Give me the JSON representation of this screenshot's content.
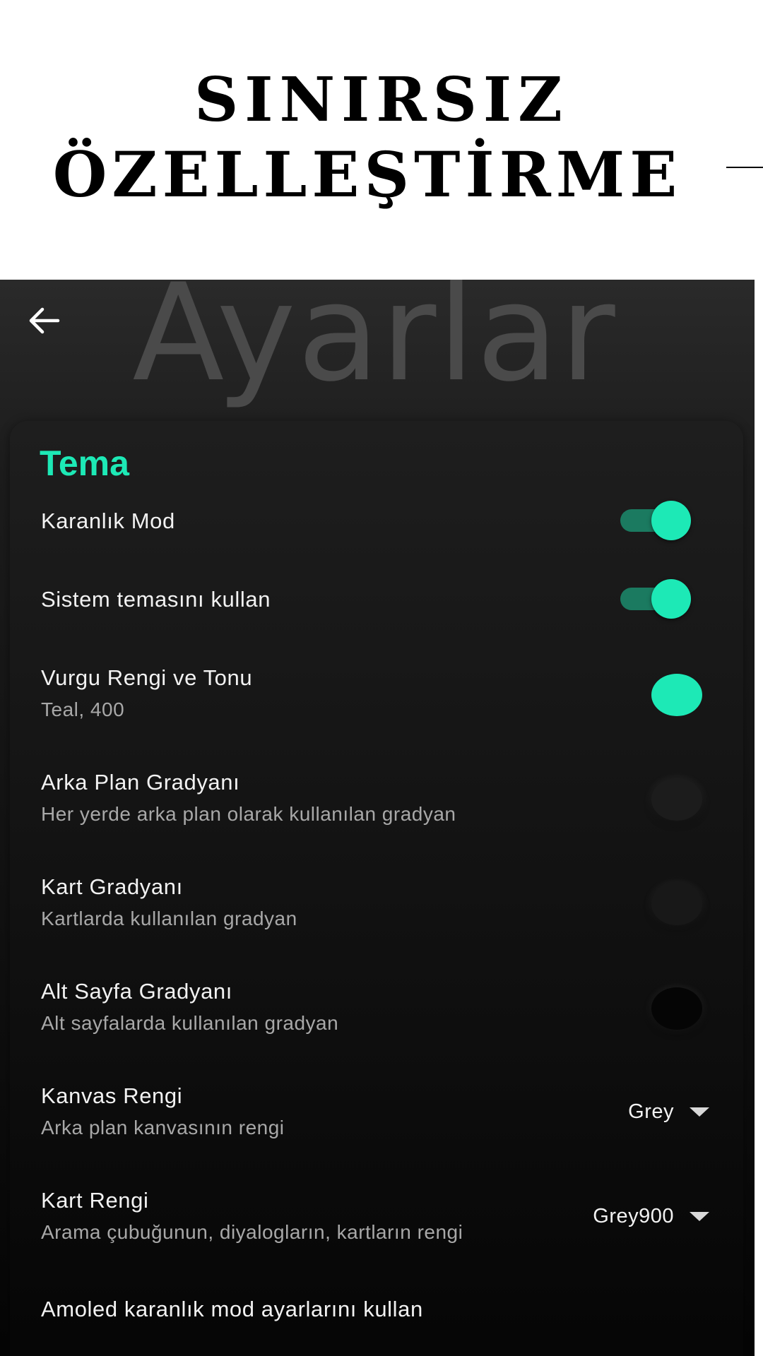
{
  "promo": {
    "line1": "SINIRSIZ",
    "line2": "ÖZELLEŞTİRME"
  },
  "header": {
    "title": "Ayarlar",
    "back_icon": "arrow-back-icon"
  },
  "section": {
    "title": "Tema"
  },
  "settings": {
    "dark_mode": {
      "label": "Karanlık Mod",
      "enabled": true
    },
    "system_theme": {
      "label": "Sistem temasını kullan",
      "enabled": true
    },
    "accent_color": {
      "label": "Vurgu Rengi ve Tonu",
      "value": "Teal, 400",
      "color": "#1de9b6"
    },
    "background_gradient": {
      "label": "Arka Plan Gradyanı",
      "description": "Her yerde arka plan olarak kullanılan gradyan",
      "color": "#1c1c1c"
    },
    "card_gradient": {
      "label": "Kart Gradyanı",
      "description": "Kartlarda kullanılan gradyan",
      "color": "#181818"
    },
    "subpage_gradient": {
      "label": "Alt Sayfa Gradyanı",
      "description": "Alt sayfalarda kullanılan gradyan",
      "color": "#050505"
    },
    "canvas_color": {
      "label": "Kanvas Rengi",
      "description": "Arka plan kanvasının rengi",
      "selected": "Grey"
    },
    "card_color": {
      "label": "Kart Rengi",
      "description": "Arama çubuğunun, diyalogların, kartların rengi",
      "selected": "Grey900"
    },
    "amoled": {
      "label": "Amoled karanlık mod ayarlarını kullan"
    }
  },
  "colors": {
    "accent": "#1de9b6",
    "accent_track": "#1b7a60",
    "title_ghost": "#4a4a4a"
  }
}
